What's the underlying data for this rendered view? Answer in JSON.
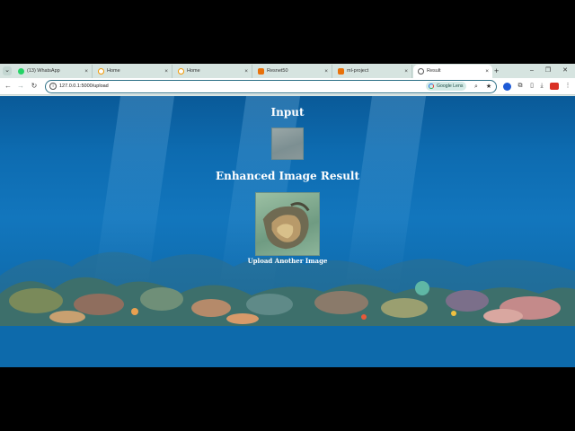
{
  "browser": {
    "tabs": [
      {
        "title": "(13) WhatsApp",
        "icon": "whatsapp-icon",
        "color": "#25d366",
        "active": false
      },
      {
        "title": "Home",
        "icon": "page-icon",
        "color": "#f29900",
        "active": false
      },
      {
        "title": "Home",
        "icon": "page-icon",
        "color": "#f29900",
        "active": false
      },
      {
        "title": "Resnet50",
        "icon": "page-icon",
        "color": "#e8710a",
        "active": false
      },
      {
        "title": "ml-project",
        "icon": "page-icon",
        "color": "#e8710a",
        "active": false
      },
      {
        "title": "Result",
        "icon": "globe-icon",
        "color": "#555555",
        "active": true
      }
    ],
    "url": "127.0.0.1:5000/upload",
    "lens_label": "Google Lens",
    "new_tab_label": "+",
    "close_glyph": "×"
  },
  "page": {
    "input_heading": "Input",
    "result_heading": "Enhanced Image Result",
    "upload_link": "Upload Another Image",
    "input_image_alt": "input-image",
    "result_image_alt": "enhanced-result-image"
  },
  "colors": {
    "accent": "#2c6f85",
    "page_background": "#0d6bb0",
    "heading_text": "#ffffff"
  }
}
